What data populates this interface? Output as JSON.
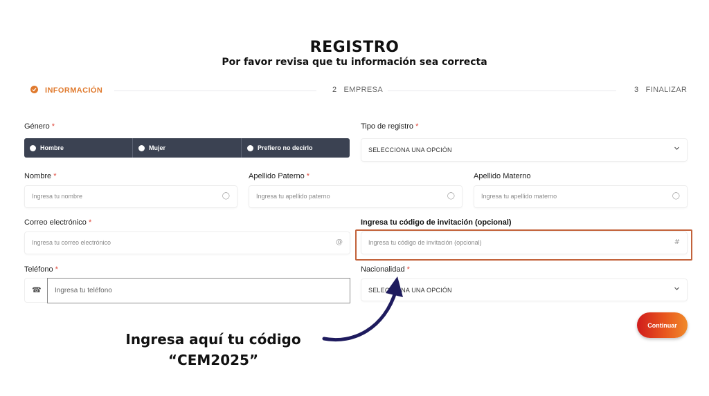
{
  "header": {
    "title": "REGISTRO",
    "subtitle": "Por favor revisa que tu información sea correcta"
  },
  "stepper": [
    {
      "label": "INFORMACIÓN",
      "number": "",
      "state": "done"
    },
    {
      "label": "EMPRESA",
      "number": "2",
      "state": "pending"
    },
    {
      "label": "FINALIZAR",
      "number": "3",
      "state": "pending"
    }
  ],
  "form": {
    "gender": {
      "label": "Género",
      "required": "*",
      "options": [
        "Hombre",
        "Mujer",
        "Prefiero no decirlo"
      ]
    },
    "registration_type": {
      "label": "Tipo de registro",
      "required": "*",
      "value": "SELECCIONA UNA OPCIÓN"
    },
    "first_name": {
      "label": "Nombre",
      "required": "*",
      "placeholder": "Ingresa tu nombre"
    },
    "last_name_paternal": {
      "label": "Apellido Paterno",
      "required": "*",
      "placeholder": "Ingresa tu apellido paterno"
    },
    "last_name_maternal": {
      "label": "Apellido Materno",
      "placeholder": "Ingresa tu apellido materno"
    },
    "email": {
      "label": "Correo electrónico",
      "required": "*",
      "placeholder": "Ingresa tu correo electrónico",
      "icon": "@"
    },
    "invitation_code": {
      "label": "Ingresa tu código de invitación (opcional)",
      "placeholder": "Ingresa tu código de invitación (opcional)",
      "icon": "#"
    },
    "phone": {
      "label": "Teléfono",
      "required": "*",
      "placeholder": "Ingresa tu teléfono"
    },
    "nationality": {
      "label": "Nacionalidad",
      "required": "*",
      "value": "SELECCIONA UNA OPCIÓN"
    }
  },
  "continue_label": "Continuar",
  "callout": {
    "line1": "Ingresa aquí tu código",
    "line2": "“CEM2025”"
  },
  "colors": {
    "accent": "#e07a2e",
    "segmented_bg": "#3b4252",
    "highlight": "#c2623a",
    "arrow": "#1e1b5e"
  }
}
